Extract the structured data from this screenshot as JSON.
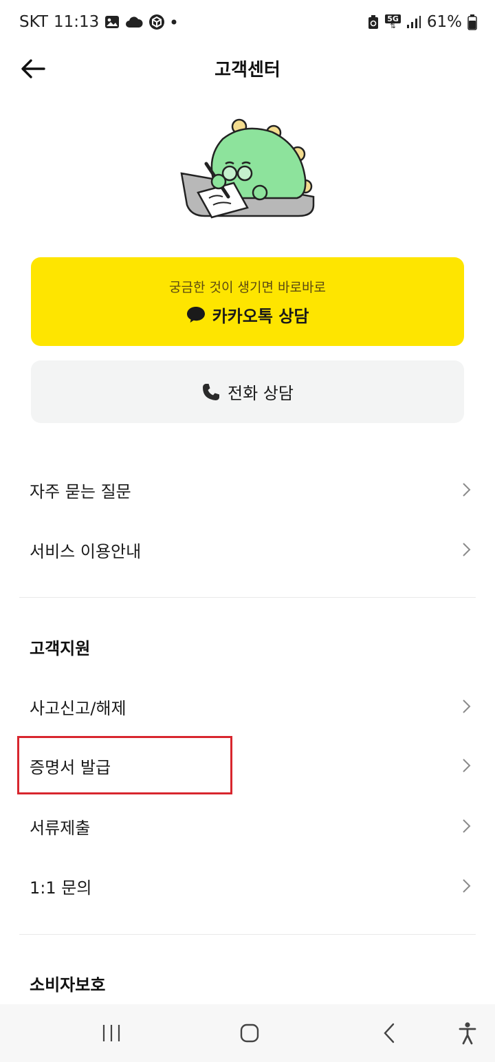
{
  "status_bar": {
    "carrier": "SKT",
    "time": "11:13",
    "network": "5G",
    "battery": "61%"
  },
  "header": {
    "title": "고객센터"
  },
  "kakao_consult": {
    "subtitle": "궁금한 것이 생기면 바로바로",
    "label": "카카오톡 상담",
    "color": "#fee500"
  },
  "phone_consult": {
    "label": "전화 상담"
  },
  "menu_top": [
    {
      "label": "자주 묻는 질문"
    },
    {
      "label": "서비스 이용안내"
    }
  ],
  "customer_support": {
    "title": "고객지원",
    "items": [
      {
        "label": "사고신고/해제"
      },
      {
        "label": "증명서 발급"
      },
      {
        "label": "서류제출"
      },
      {
        "label": "1:1 문의"
      }
    ]
  },
  "consumer_protection": {
    "title": "소비자보호"
  },
  "accent_colors": {
    "highlight": "#d8262e",
    "illustration_green": "#8de39c"
  }
}
